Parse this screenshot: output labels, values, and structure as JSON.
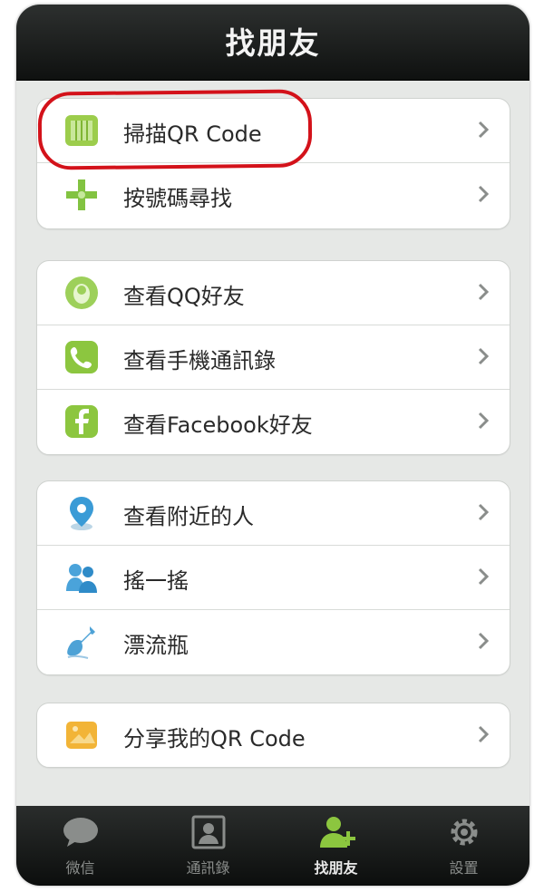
{
  "header": {
    "title": "找朋友"
  },
  "groups": [
    {
      "items": [
        {
          "label": "掃描QR Code",
          "icon": "qr-scan-icon"
        },
        {
          "label": "按號碼尋找",
          "icon": "plus-search-icon"
        }
      ]
    },
    {
      "items": [
        {
          "label": "查看QQ好友",
          "icon": "qq-icon"
        },
        {
          "label": "查看手機通訊錄",
          "icon": "phone-icon"
        },
        {
          "label": "查看Facebook好友",
          "icon": "facebook-icon"
        }
      ]
    },
    {
      "items": [
        {
          "label": "查看附近的人",
          "icon": "location-pin-icon"
        },
        {
          "label": "搖一搖",
          "icon": "shake-icon"
        },
        {
          "label": "漂流瓶",
          "icon": "bottle-icon"
        }
      ]
    },
    {
      "items": [
        {
          "label": "分享我的QR Code",
          "icon": "share-qr-icon"
        }
      ]
    }
  ],
  "tabbar": {
    "tabs": [
      {
        "label": "微信",
        "icon": "chat-bubble-icon",
        "active": false
      },
      {
        "label": "通訊錄",
        "icon": "contacts-icon",
        "active": false
      },
      {
        "label": "找朋友",
        "icon": "find-friends-icon",
        "active": true
      },
      {
        "label": "設置",
        "icon": "gear-icon",
        "active": false
      }
    ]
  },
  "colors": {
    "highlight_ring": "#d3121a",
    "accent_green": "#8cc63f",
    "bar_dark": "#111312"
  }
}
